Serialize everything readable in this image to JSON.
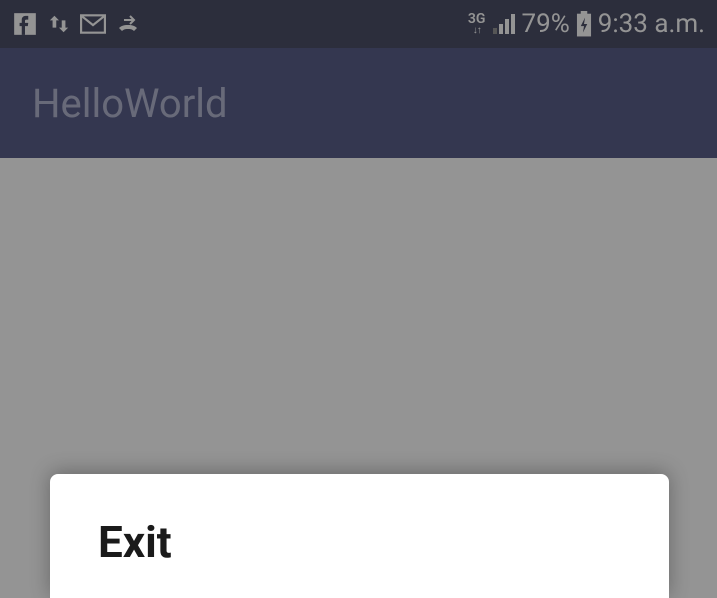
{
  "statusBar": {
    "network": "3G",
    "battery": "79%",
    "time": "9:33 a.m."
  },
  "appBar": {
    "title": "HelloWorld"
  },
  "dialog": {
    "title": "Exit"
  }
}
